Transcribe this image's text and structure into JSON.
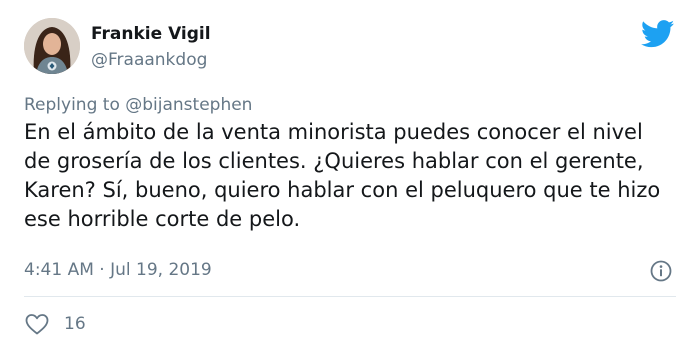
{
  "tweet": {
    "author_name": "Frankie Vigil",
    "author_handle": "@Fraaankdog",
    "replying_prefix": "Replying to ",
    "replying_to": "@bijanstephen",
    "body": "En el ámbito de la venta minorista puedes conocer el nivel de grosería de los clientes. ¿Quieres hablar con el gerente, Karen? Sí, bueno, quiero hablar con el peluquero que te hizo ese horrible corte de pelo.",
    "timestamp": "4:41 AM · Jul 19, 2019",
    "like_count": "16"
  },
  "icons": {
    "brand": "twitter-bird-icon",
    "info": "info-icon",
    "like": "heart-icon"
  },
  "colors": {
    "twitter_blue": "#1da1f2",
    "text_primary": "#14171a",
    "text_secondary": "#657786",
    "divider": "#e1e8ed"
  }
}
